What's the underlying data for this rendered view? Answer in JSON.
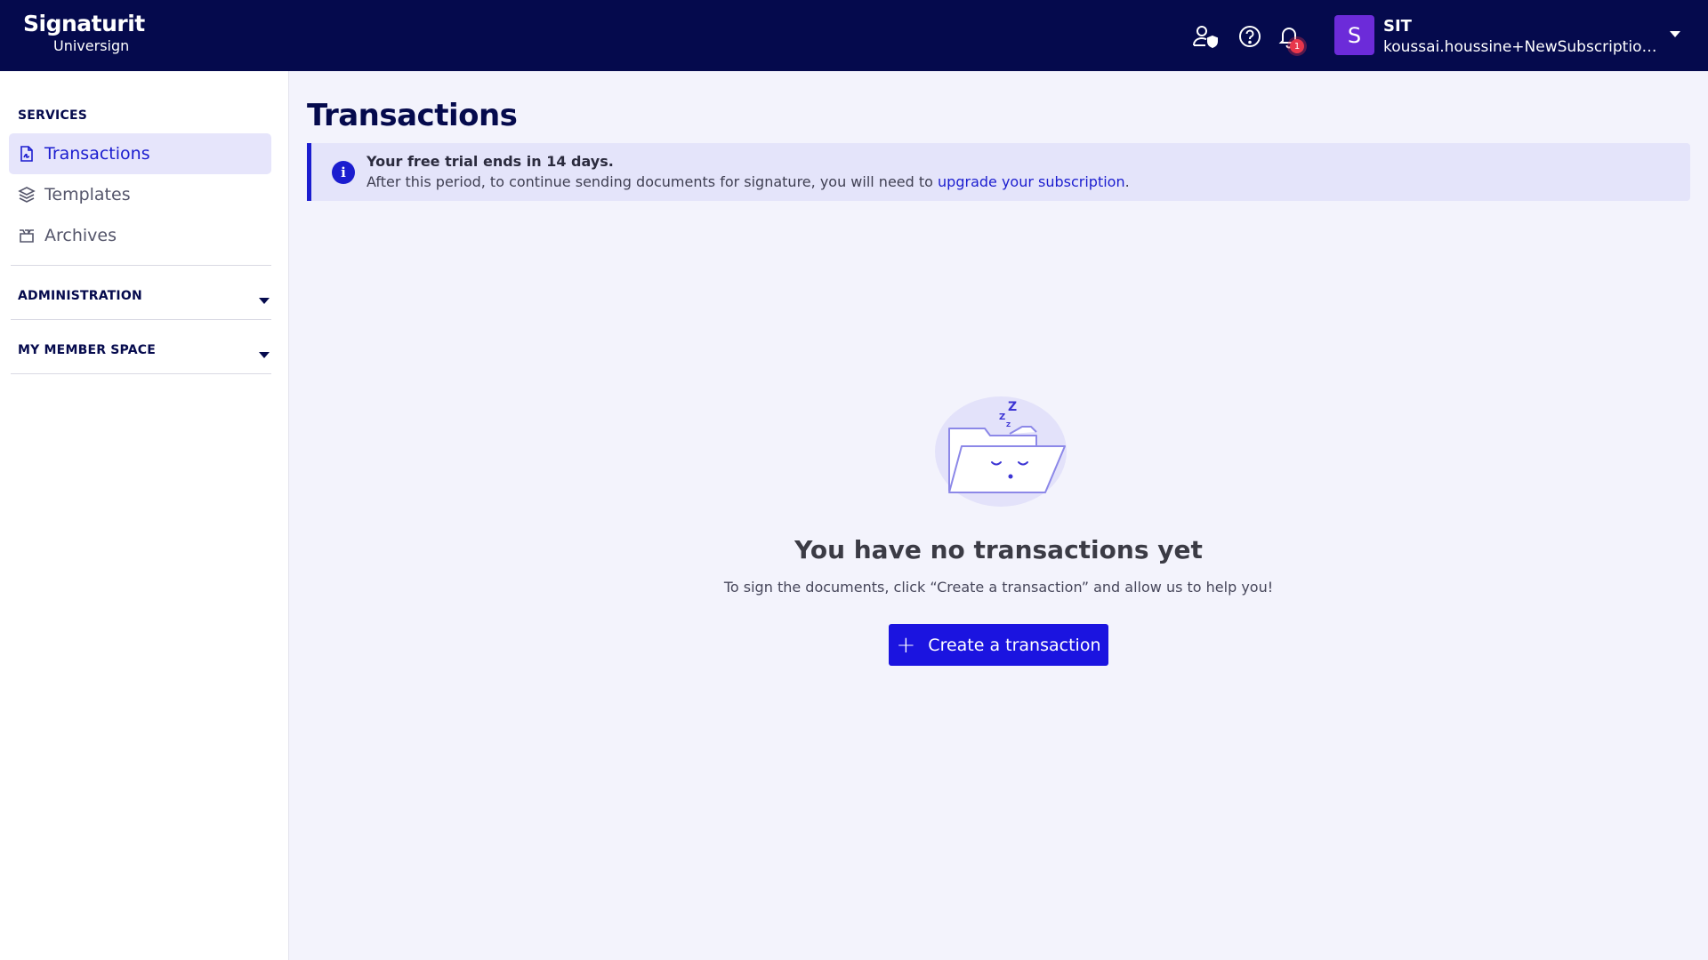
{
  "header": {
    "logo_main": "Signaturit",
    "logo_sub": "Universign",
    "notifications_count": "1",
    "avatar_letter": "S",
    "user_name": "SIT",
    "user_email": "koussai.houssine+NewSubscription@u..."
  },
  "sidebar": {
    "services_label": "SERVICES",
    "items": [
      {
        "label": "Transactions",
        "icon": "document-icon",
        "active": true
      },
      {
        "label": "Templates",
        "icon": "layers-icon"
      },
      {
        "label": "Archives",
        "icon": "archive-box-icon"
      }
    ],
    "administration_label": "ADMINISTRATION",
    "member_space_label": "MY MEMBER SPACE"
  },
  "main": {
    "title": "Transactions",
    "banner": {
      "title": "Your free trial ends in 14 days.",
      "text": "After this period, to continue sending documents for signature, you will need to ",
      "link": "upgrade your subscription",
      "suffix": "."
    },
    "empty_title": "You have no transactions yet",
    "empty_text": "To sign the documents, click “Create a transaction” and allow us to help you!",
    "create_button": "Create a transaction"
  },
  "colors": {
    "header_bg": "#050a4d",
    "accent": "#1b1dcf",
    "button": "#1b14e0",
    "badge": "#e8364b",
    "avatar": "#6c2bd9"
  }
}
